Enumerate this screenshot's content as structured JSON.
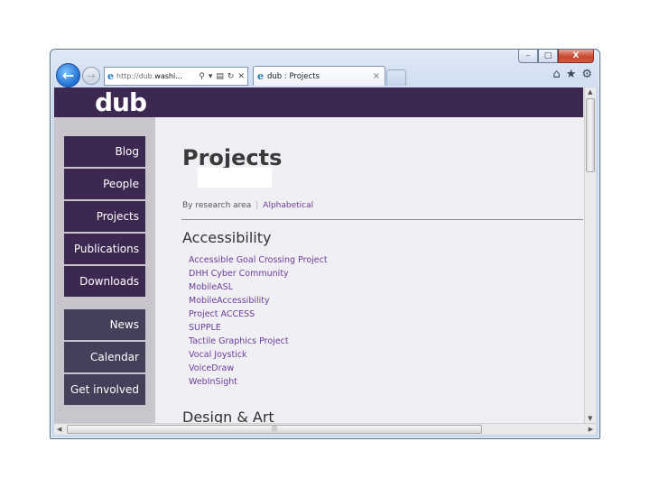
{
  "browser": {
    "address": {
      "prefix": "http://dub.",
      "host": "washi..."
    },
    "tab_title": "dub : Projects",
    "tab_close": "×",
    "caption": {
      "minimize": "–",
      "restore": "□",
      "close": "X"
    }
  },
  "site": {
    "logo": "dub",
    "nav_primary": [
      "Blog",
      "People",
      "Projects",
      "Publications",
      "Downloads"
    ],
    "nav_secondary": [
      "News",
      "Calendar",
      "Get involved"
    ]
  },
  "page": {
    "title": "Projects",
    "subnav": {
      "prefix": "By research area",
      "link": "Alphabetical"
    },
    "sections": [
      {
        "title": "Accessibility",
        "projects": [
          "Accessible Goal Crossing Project",
          "DHH Cyber Community",
          "MobileASL",
          "MobileAccessibility",
          "Project ACCESS",
          "SUPPLE",
          "Tactile Graphics Project",
          "Vocal Joystick",
          "VoiceDraw",
          "WebInSight"
        ]
      },
      {
        "title": "Design & Art"
      }
    ]
  },
  "icons": {
    "back": "back-arrow-icon",
    "forward": "forward-arrow-icon",
    "home": "home-icon",
    "favorites": "star-icon",
    "tools": "gear-icon"
  }
}
